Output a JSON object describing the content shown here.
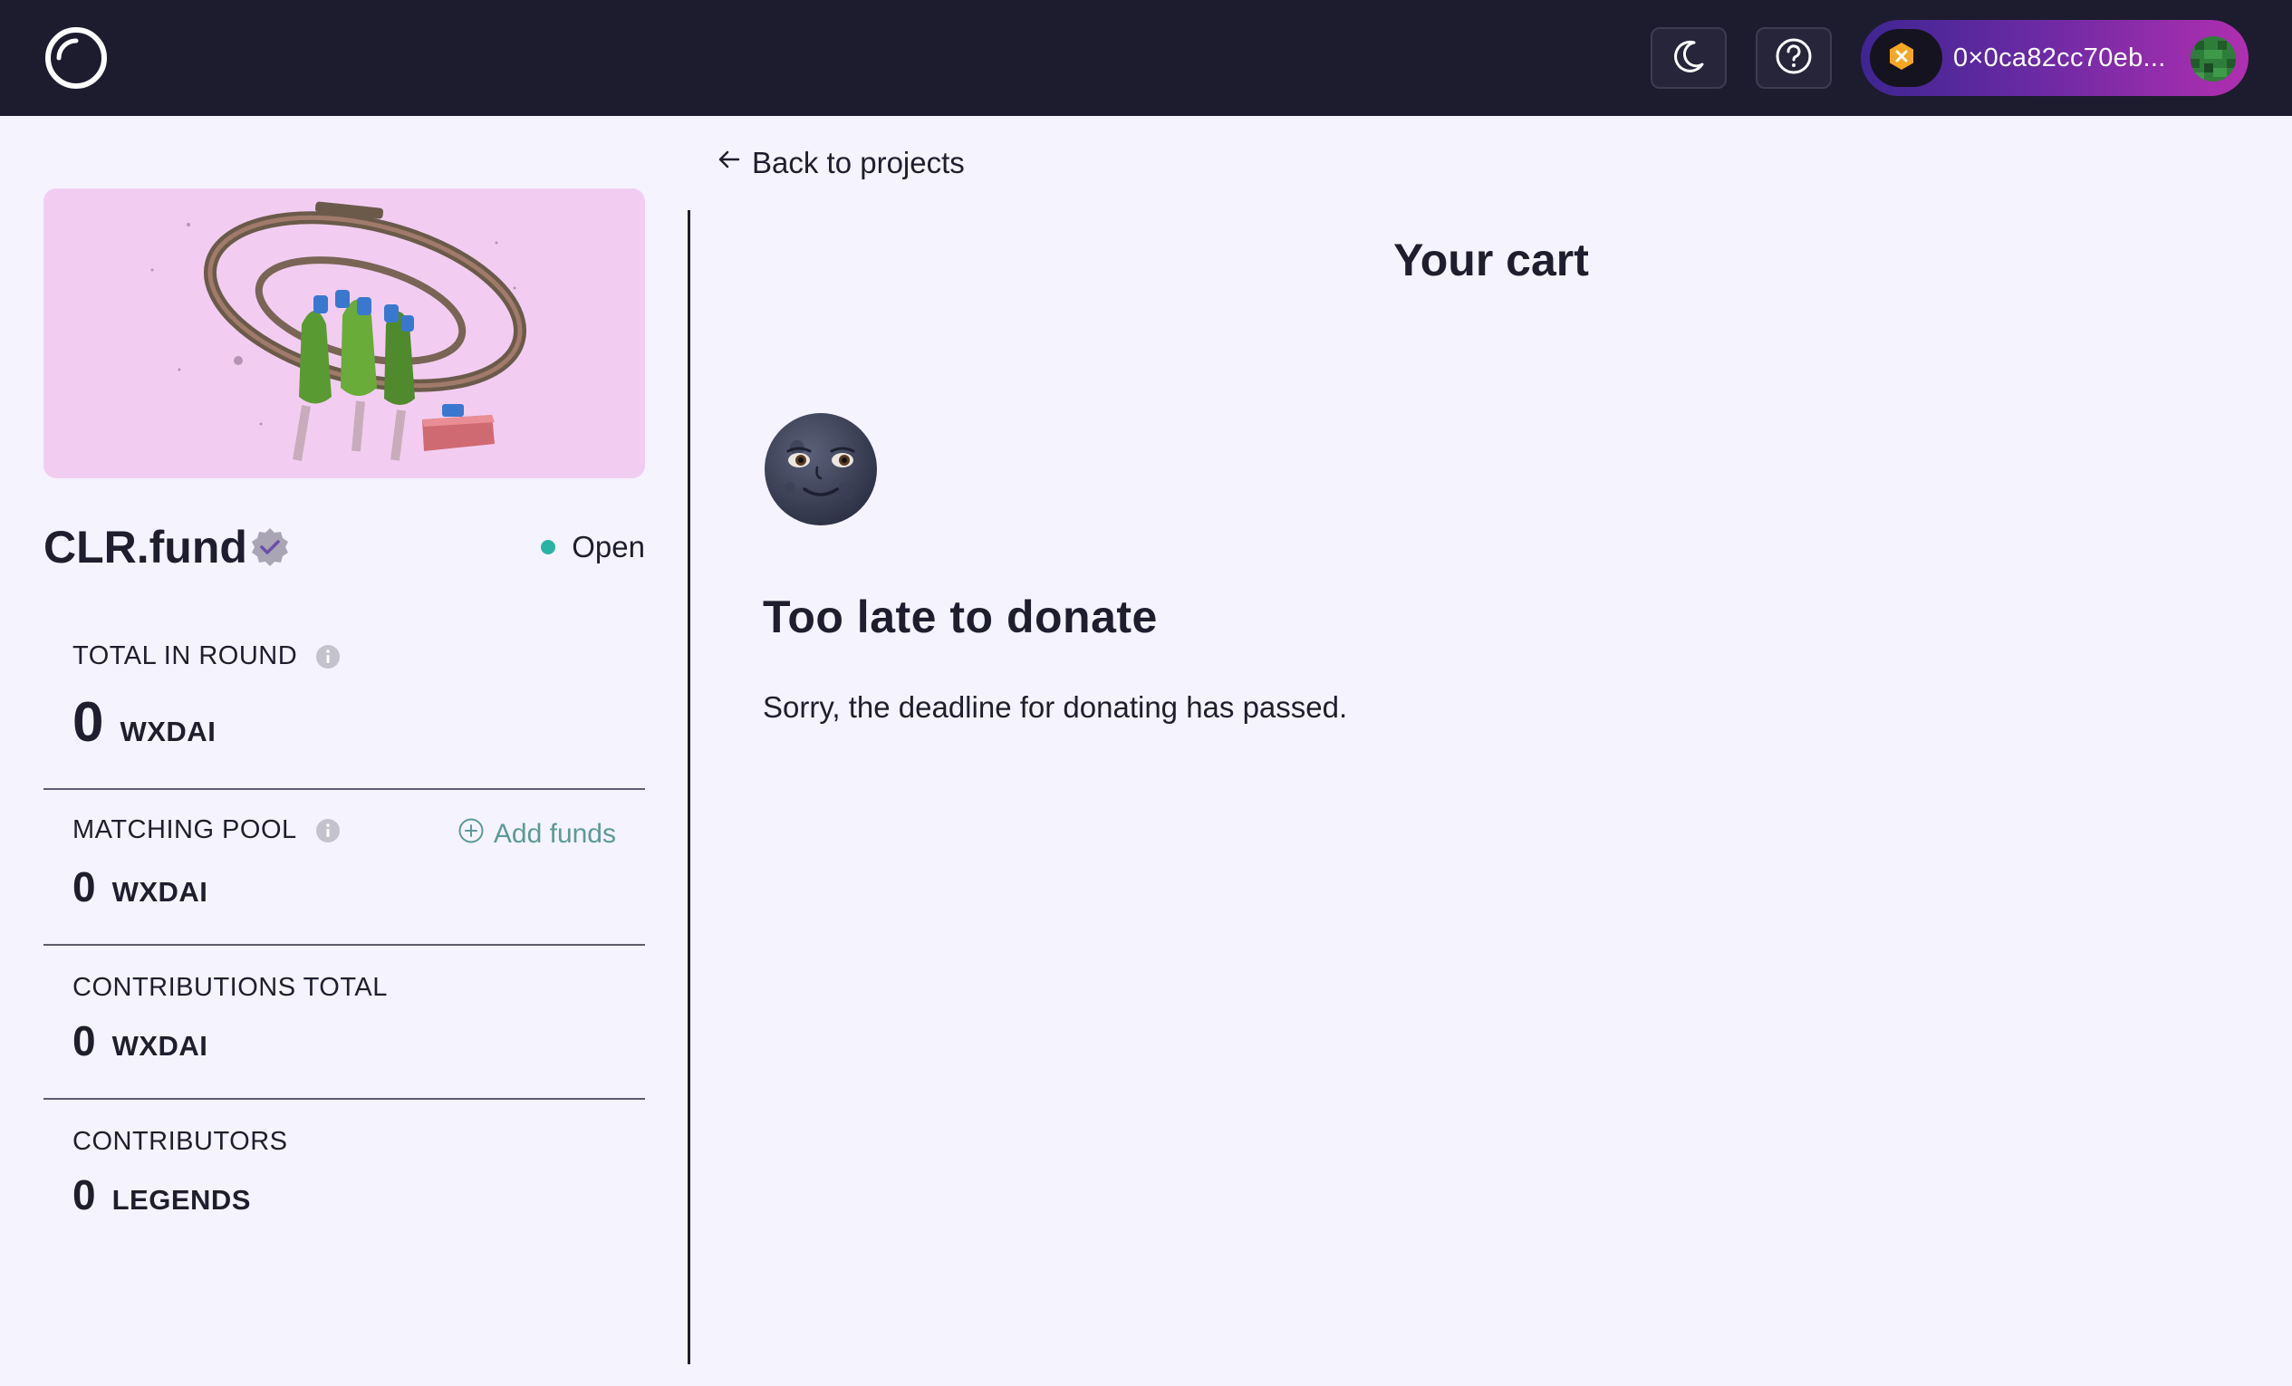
{
  "header": {
    "wallet_address": "0×0ca82cc70eb..."
  },
  "navigation": {
    "back_label": "Back to projects"
  },
  "project": {
    "name": "CLR.fund",
    "status": "Open"
  },
  "stats": {
    "total_in_round": {
      "label": "TOTAL IN ROUND",
      "value": "0",
      "unit": "WXDAI"
    },
    "matching_pool": {
      "label": "MATCHING POOL",
      "value": "0",
      "unit": "WXDAI",
      "action_label": "Add funds"
    },
    "contributions_total": {
      "label": "CONTRIBUTIONS TOTAL",
      "value": "0",
      "unit": "WXDAI"
    },
    "contributors": {
      "label": "CONTRIBUTORS",
      "value": "0",
      "unit": "LEGENDS"
    }
  },
  "cart": {
    "title": "Your cart",
    "heading": "Too late to donate",
    "message": "Sorry, the deadline for donating has passed."
  },
  "colors": {
    "topbar": "#1d1c2f",
    "background": "#f5f3fe",
    "status_open": "#2ab3a3",
    "accent_link": "#5c9a96",
    "image_background": "#f2cdf1"
  },
  "icons": {
    "logo": "clrfund-logo-icon",
    "theme": "moon-crescent-icon",
    "help": "question-circle-icon",
    "chain": "xdai-chain-icon",
    "back": "arrow-left-icon",
    "verified": "verified-badge-icon",
    "info": "info-icon",
    "add": "plus-circle-icon",
    "empty_state": "new-moon-face-icon"
  }
}
